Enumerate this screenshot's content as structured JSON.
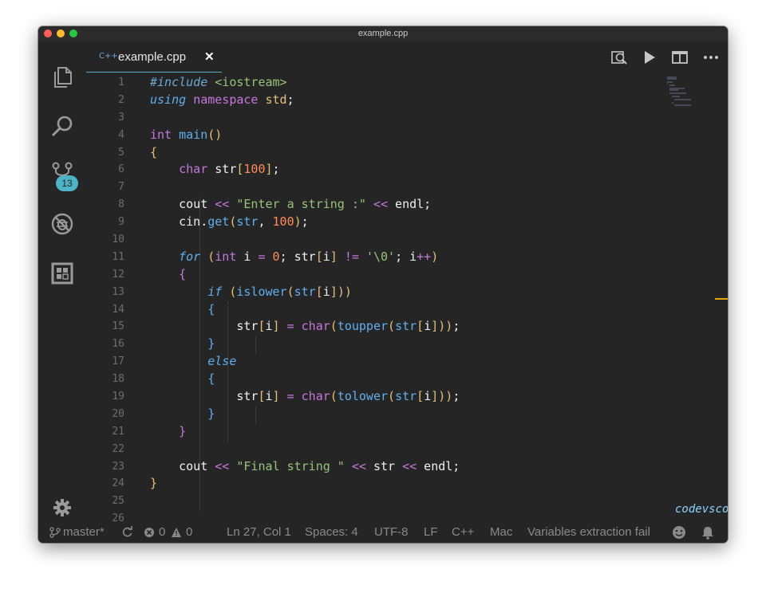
{
  "window": {
    "title": "example.cpp"
  },
  "activity_bar": {
    "items": [
      "explorer-icon",
      "search-icon",
      "source-control-icon",
      "debug-icon",
      "extensions-icon"
    ],
    "scm_badge": "13",
    "settings_icon": "gear-icon"
  },
  "tab": {
    "label": "example.cpp",
    "close": "✕",
    "icon": "C++"
  },
  "toolbar": [
    "open-preview-icon",
    "run-icon",
    "split-editor-icon",
    "more-actions-icon"
  ],
  "editor": {
    "line_numbers": [
      "1",
      "2",
      "3",
      "4",
      "5",
      "6",
      "7",
      "8",
      "9",
      "10",
      "11",
      "12",
      "13",
      "14",
      "15",
      "16",
      "17",
      "18",
      "19",
      "20",
      "21",
      "22",
      "23",
      "24",
      "25",
      "26"
    ],
    "lines": [
      "#include <iostream>",
      "using namespace std;",
      "",
      "int main()",
      "{",
      "    char str[100];",
      "",
      "    cout << \"Enter a string :\" << endl;",
      "    cin.get(str, 100);",
      "",
      "    for (int i = 0; str[i] != '\\0'; i++)",
      "    {",
      "        if (islower(str[i]))",
      "        {",
      "            str[i] = char(toupper(str[i]));",
      "        }",
      "        else",
      "        {",
      "            str[i] = char(tolower(str[i]));",
      "        }",
      "    }",
      "",
      "    cout << \"Final string \" << str << endl;",
      "}",
      "",
      ""
    ],
    "watermark": "codevscolor.com"
  },
  "statusbar": {
    "branch": "master*",
    "errors": "0",
    "warnings": "0",
    "position": "Ln 27, Col 1",
    "spaces": "Spaces: 4",
    "encoding": "UTF-8",
    "eol": "LF",
    "language": "C++",
    "platform": "Mac",
    "message": "Variables extraction fail"
  },
  "colors": {
    "background": "#252526",
    "accent": "#4fb3c8",
    "keyword": "#c678dd",
    "function": "#61afef",
    "string": "#98c379",
    "number": "#ff8c5a",
    "bracket": "#e5c07b"
  }
}
